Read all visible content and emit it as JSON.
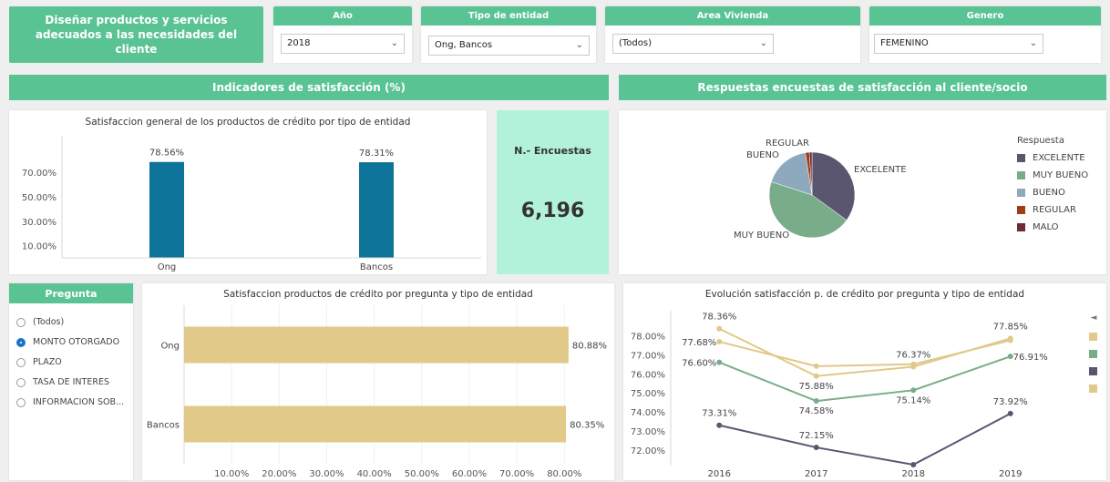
{
  "header": {
    "title": "Diseñar productos y servicios adecuados a las necesidades del cliente"
  },
  "filters": [
    {
      "label": "Año",
      "value": "2018"
    },
    {
      "label": "Tipo de entidad",
      "value": "Ong, Bancos"
    },
    {
      "label": "Area Vivienda",
      "value": "(Todos)"
    },
    {
      "label": "Genero",
      "value": "FEMENINO"
    }
  ],
  "sections": {
    "left": "Indicadores de satisfacción (%)",
    "right": "Respuestas encuestas de satisfacción al cliente/socio"
  },
  "kpi": {
    "label": "N.- Encuestas",
    "value": "6,196"
  },
  "pregunta": {
    "title": "Pregunta",
    "options": [
      {
        "label": "(Todos)",
        "selected": false
      },
      {
        "label": "MONTO OTORGADO",
        "selected": true
      },
      {
        "label": "PLAZO",
        "selected": false
      },
      {
        "label": "TASA DE INTERES",
        "selected": false
      },
      {
        "label": "INFORMACION SOB...",
        "selected": false
      }
    ]
  },
  "colors": {
    "accent": "#5ac394",
    "bar_blue": "#0e7499",
    "bar_tan": "#e1c98a",
    "kpi_bg": "#b3f2da"
  },
  "chart_data": [
    {
      "type": "bar",
      "title": "Satisfaccion  general de los productos de crédito por tipo de entidad",
      "categories": [
        "Ong",
        "Bancos"
      ],
      "values": [
        78.56,
        78.31
      ],
      "value_labels": [
        "78.56%",
        "78.31%"
      ],
      "y_ticks": [
        "10.00%",
        "30.00%",
        "50.00%",
        "70.00%"
      ],
      "ylim": [
        0,
        100
      ]
    },
    {
      "type": "pie",
      "legend_title": "Respuesta",
      "slices": [
        {
          "label": "EXCELENTE",
          "value": 35,
          "color": "#5b5670"
        },
        {
          "label": "MUY BUENO",
          "value": 45,
          "color": "#79ad8a"
        },
        {
          "label": "BUENO",
          "value": 17.5,
          "color": "#8ea9bd"
        },
        {
          "label": "REGULAR",
          "value": 1.5,
          "color": "#a03c16"
        },
        {
          "label": "MALO",
          "value": 1,
          "color": "#6e2b3a"
        }
      ],
      "legend": [
        "EXCELENTE",
        "MUY BUENO",
        "BUENO",
        "REGULAR",
        "MALO"
      ],
      "legend_placement": "right"
    },
    {
      "type": "bar",
      "orientation": "horizontal",
      "title": "Satisfaccion productos de crédito por pregunta y tipo de entidad",
      "categories": [
        "Ong",
        "Bancos"
      ],
      "values": [
        80.88,
        80.35
      ],
      "value_labels": [
        "80.88%",
        "80.35%"
      ],
      "x_ticks": [
        "10.00%",
        "20.00%",
        "30.00%",
        "40.00%",
        "50.00%",
        "60.00%",
        "70.00%",
        "80.00%"
      ],
      "xlim": [
        0,
        88
      ]
    },
    {
      "type": "line",
      "title": "Evolución satisfacción p. de crédito por pregunta y tipo de entidad",
      "x": [
        "2016",
        "2017",
        "2018",
        "2019"
      ],
      "y_ticks": [
        "72.00%",
        "73.00%",
        "74.00%",
        "75.00%",
        "76.00%",
        "77.00%",
        "78.00%"
      ],
      "ylim": [
        71.2,
        79.3
      ],
      "series": [
        {
          "color": "#e1c98a",
          "values": [
            78.36,
            75.88,
            76.37,
            77.85
          ],
          "labels": [
            "78.36%",
            "75.88%",
            "76.37%",
            "77.85%"
          ]
        },
        {
          "color": "#e1c98a",
          "values": [
            77.68,
            76.4,
            76.5,
            77.75
          ],
          "labels": [
            "77.68%",
            "",
            "",
            ""
          ]
        },
        {
          "color": "#79ad8a",
          "values": [
            76.6,
            74.58,
            75.14,
            76.91
          ],
          "labels": [
            "76.60%",
            "74.58%",
            "75.14%",
            "76.91%"
          ]
        },
        {
          "color": "#5b5670",
          "values": [
            73.31,
            72.15,
            71.25,
            73.92
          ],
          "labels": [
            "73.31%",
            "72.15%",
            "",
            "73.92%"
          ]
        }
      ],
      "legend_colors": [
        "#e1c98a",
        "#79ad8a",
        "#5b5670",
        "#e1c98a"
      ]
    }
  ]
}
